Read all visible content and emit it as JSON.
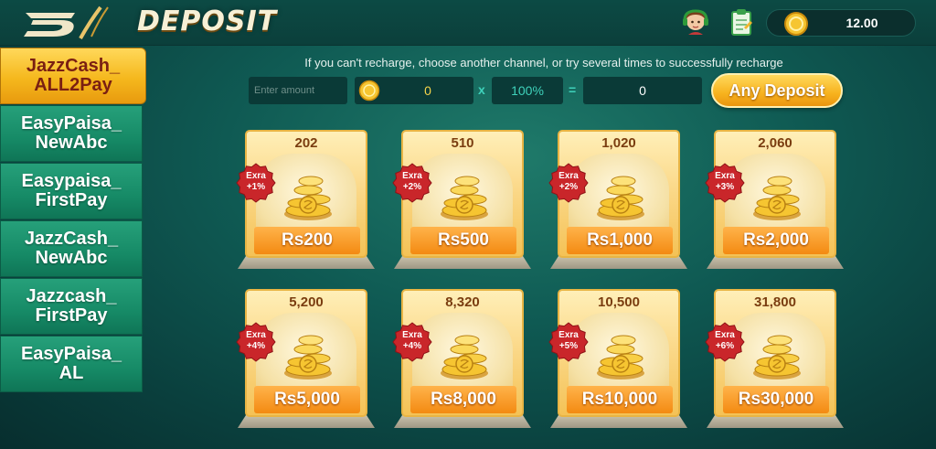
{
  "header": {
    "title": "DEPOSIT",
    "balance": "12.00",
    "icons": [
      "logo-icon",
      "avatar-icon",
      "clipboard-icon",
      "coin-icon"
    ]
  },
  "sidebar": {
    "items": [
      {
        "label": "JazzCash_\nALL2Pay",
        "active": true
      },
      {
        "label": "EasyPaisa_\nNewAbc",
        "active": false
      },
      {
        "label": "Easypaisa_\nFirstPay",
        "active": false
      },
      {
        "label": "JazzCash_\nNewAbc",
        "active": false
      },
      {
        "label": "Jazzcash_\nFirstPay",
        "active": false
      },
      {
        "label": "EasyPaisa_\nAL",
        "active": false
      }
    ]
  },
  "main": {
    "hint": "If you can't recharge, choose another channel, or try several times to successfully recharge",
    "amount_placeholder": "Enter amount",
    "coin_value": "0",
    "times": "x",
    "percent": "100%",
    "equals": "=",
    "total": "0",
    "any_deposit_label": "Any Deposit"
  },
  "cards": [
    {
      "coins": "202",
      "price": "Rs200",
      "bonus": "+1%",
      "extra": "Exra"
    },
    {
      "coins": "510",
      "price": "Rs500",
      "bonus": "+2%",
      "extra": "Exra"
    },
    {
      "coins": "1,020",
      "price": "Rs1,000",
      "bonus": "+2%",
      "extra": "Exra"
    },
    {
      "coins": "2,060",
      "price": "Rs2,000",
      "bonus": "+3%",
      "extra": "Exra"
    },
    {
      "coins": "5,200",
      "price": "Rs5,000",
      "bonus": "+4%",
      "extra": "Exra"
    },
    {
      "coins": "8,320",
      "price": "Rs8,000",
      "bonus": "+4%",
      "extra": "Exra"
    },
    {
      "coins": "10,500",
      "price": "Rs10,000",
      "bonus": "+5%",
      "extra": "Exra"
    },
    {
      "coins": "31,800",
      "price": "Rs30,000",
      "bonus": "+6%",
      "extra": "Exra"
    }
  ],
  "colors": {
    "accent_gold": "#f5b81d",
    "active_text": "#7a1f12",
    "teal": "#3fd2bb",
    "badge_red": "#c9262a"
  }
}
